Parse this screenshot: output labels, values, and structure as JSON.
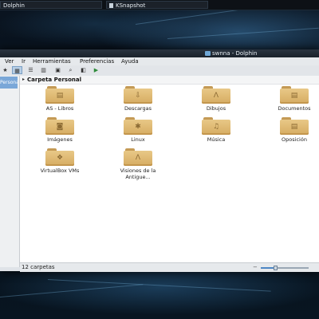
{
  "taskbar": {
    "tasks": [
      {
        "label": "Dolphin"
      },
      {
        "label": "KSnapshot"
      }
    ]
  },
  "window": {
    "title": "swnna - Dolphin",
    "menu": [
      "Ver",
      "Ir",
      "Herramientas",
      "Preferencias",
      "Ayuda"
    ],
    "toolbar_icons": [
      "star-icon",
      "icons-view-icon",
      "details-view-icon",
      "columns-view-icon",
      "preview-icon",
      "search-icon",
      "split-icon",
      "terminal-icon"
    ],
    "sidebar": {
      "place": "Personal"
    },
    "breadcrumb": {
      "text": "Carpeta Personal"
    },
    "items": [
      {
        "label": "AS - Libros",
        "icon": "document-folder-icon"
      },
      {
        "label": "Descargas",
        "icon": "download-folder-icon"
      },
      {
        "label": "Dibujos",
        "icon": "drawing-folder-icon"
      },
      {
        "label": "Documentos",
        "icon": "document-folder-icon"
      },
      {
        "label": "Imágenes",
        "icon": "image-folder-icon"
      },
      {
        "label": "Linux",
        "icon": "linux-folder-icon"
      },
      {
        "label": "Música",
        "icon": "music-folder-icon"
      },
      {
        "label": "Oposición",
        "icon": "document-folder-icon"
      },
      {
        "label": "VirtualBox VMs",
        "icon": "virtualbox-folder-icon"
      },
      {
        "label": "Visiones de la Antigue...",
        "icon": "drawing-folder-icon"
      }
    ],
    "status": {
      "text": "12 carpetas",
      "zoom": 0.3
    }
  },
  "colors": {
    "folder": "#d9b06a",
    "selection": "#7aa7d8",
    "titlebar": "#1a222b"
  }
}
